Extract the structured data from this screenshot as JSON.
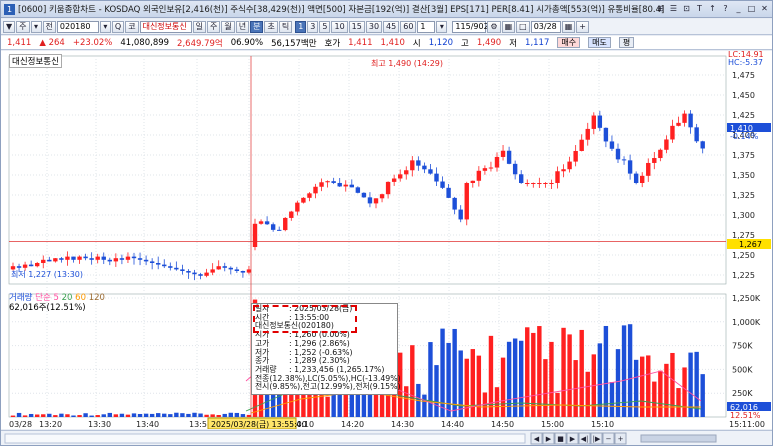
{
  "window": {
    "num": "1",
    "title": "[0600] 키움종합차트 - KOSDAQ 외국인보유[2,416(천)] 주식수[38,429(천)] 액면[500] 자본금[192(억)] 결산[3월] EPS[171] PER[8.41] 시가총액[553(억)] 유통비율[80.4]",
    "controls": [
      "⊞",
      "☰",
      "⊡",
      "T",
      "↑",
      "?",
      "_",
      "□",
      "✕"
    ]
  },
  "toolbar": {
    "b1": "▼",
    "b2": "주",
    "b3": "▾",
    "b4": "전",
    "code": "020180",
    "b5": "▾",
    "b6": "Q",
    "b7": "코",
    "name": "대신정보통신",
    "periods": [
      "일",
      "주",
      "월",
      "년",
      "분",
      "초",
      "틱"
    ],
    "active_period": "분",
    "mins": [
      "1",
      "3",
      "5",
      "10",
      "15",
      "30",
      "45",
      "60"
    ],
    "active_min": "1",
    "unit": "1",
    "count": "115/902",
    "date": "03/28"
  },
  "quote": {
    "price": "1,411",
    "arrow": "▲",
    "change": "264",
    "pct": "+23.02%",
    "volume": "41,080,899",
    "amount": "2,649.79억",
    "turnover": "06.90%",
    "vol2": "56,157백만",
    "hoga": "호가",
    "ask": "1,411",
    "bid": "1,410",
    "open_l": "시",
    "open": "1,120",
    "high_l": "고",
    "high": "1,490",
    "low_l": "저",
    "low": "1,117",
    "buy": "매수",
    "sell": "매도",
    "flat": "평"
  },
  "chart": {
    "series_label": "대신정보통신",
    "lc": "LC:14.91",
    "hc": "HC:-5.37",
    "high_annot": "최고 1,490 (14:29)",
    "low_annot": "최저 1,227 (13:30)",
    "cur_price": "1,410",
    "cur_pct": "-0.14%",
    "ref_price": "1,267",
    "y_ticks": [
      "1,475",
      "1,450",
      "1,425",
      "1,400",
      "1,375",
      "1,350",
      "1,325",
      "1,300",
      "1,275",
      "1,250",
      "1,225"
    ],
    "vol_legend": {
      "label": "거래량",
      "ma_label": "단순",
      "p1": "5",
      "p2": "20",
      "p3": "60",
      "p4": "120",
      "value": "62,016주(12.51%)"
    },
    "vol_ticks": [
      "1,250K",
      "1,000K",
      "750K",
      "500K",
      "250K"
    ],
    "vol_cur": "62,016",
    "vol_cur_pct": "12.51%",
    "x_ticks": [
      "03/28",
      "13:20",
      "13:30",
      "13:40",
      "13:50",
      "14:00",
      "14:10",
      "14:20",
      "14:30",
      "14:40",
      "14:50",
      "15:00",
      "15:10",
      "15:11:00"
    ],
    "cursor_label": "2025/03/28(금) 13:55:00"
  },
  "tooltip": [
    [
      "일자",
      ": 2025/03/28(금)"
    ],
    [
      "시간",
      ": 13:55:00"
    ],
    [
      "대신정보통신(020180)",
      ""
    ],
    [
      "시가",
      ": 1,260 (0.00%)"
    ],
    [
      "고가",
      ": 1,296 (2.86%)"
    ],
    [
      "저가",
      ": 1,252 (-0.63%)"
    ],
    [
      "종가",
      ": 1,289 (2.30%)"
    ],
    [
      "거래량",
      ": 1,233,456 (1,265.17%)"
    ],
    [
      "전종(12.38%),LC(5.05%),HC(-13.49%)",
      ""
    ],
    [
      "전시(9.85%),전고(12.99%),전저(9.15%)",
      ""
    ]
  ],
  "colors": {
    "up": "#ff2020",
    "down": "#1d4fd8",
    "grid": "#dfe4ea",
    "ma5": "#ff4fa0",
    "ma20": "#3aa050",
    "ma60": "#ff9a00",
    "ma120": "#9a6a30"
  }
}
